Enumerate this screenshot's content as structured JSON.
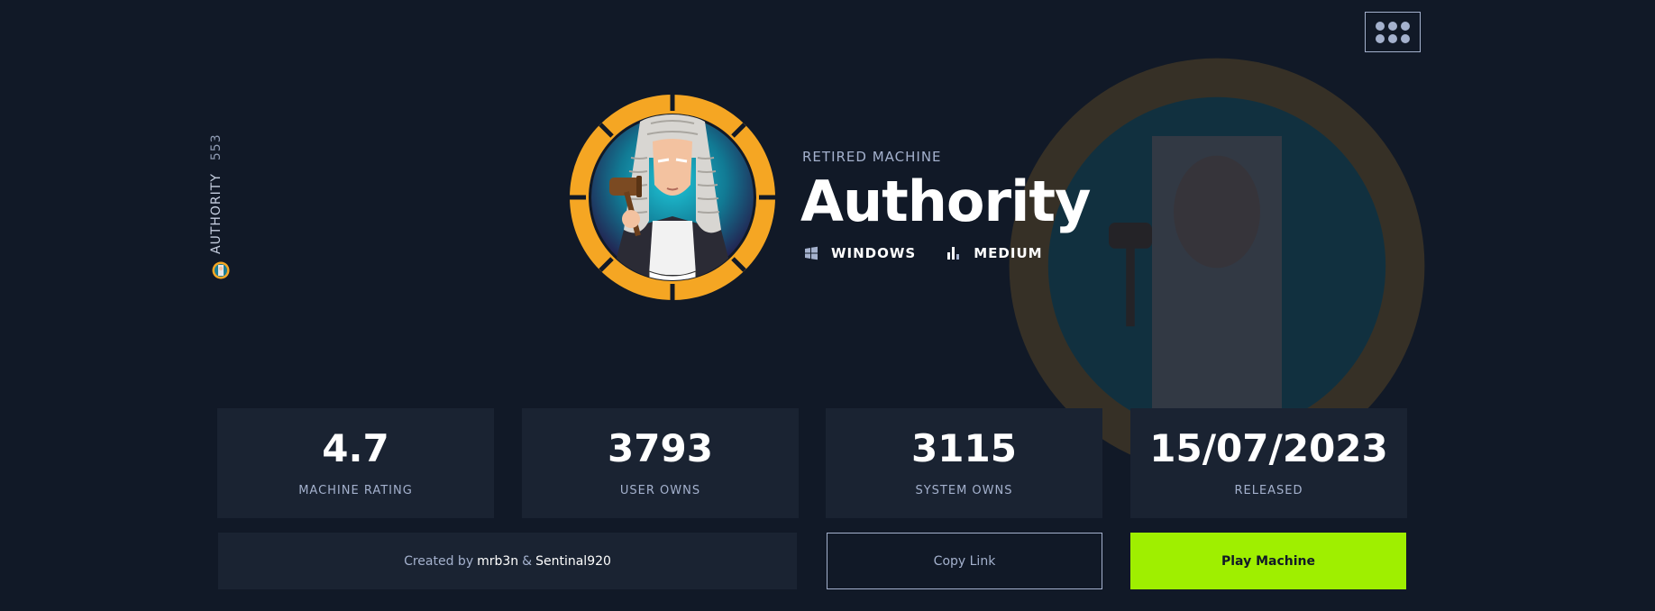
{
  "machine": {
    "status_label": "RETIRED MACHINE",
    "name": "Authority",
    "id_number": "553",
    "side_name": "AUTHORITY",
    "os": "WINDOWS",
    "difficulty": "MEDIUM"
  },
  "stats": [
    {
      "value": "4.7",
      "label": "MACHINE RATING"
    },
    {
      "value": "3793",
      "label": "USER OWNS"
    },
    {
      "value": "3115",
      "label": "SYSTEM OWNS"
    },
    {
      "value": "15/07/2023",
      "label": "RELEASED"
    }
  ],
  "credits": {
    "prefix": "Created by",
    "author1": "mrb3n",
    "separator": "&",
    "author2": "Sentinal920"
  },
  "actions": {
    "copy_link": "Copy Link",
    "play": "Play Machine"
  },
  "icons": {
    "menu": "grid-menu-icon",
    "os": "windows-icon",
    "difficulty": "bar-chart-icon",
    "avatar": "judge-avatar"
  },
  "colors": {
    "background": "#111927",
    "card": "#1a2332",
    "accent_green": "#9fef00",
    "avatar_ring": "#f5a623",
    "muted_text": "#a4b1cd"
  }
}
